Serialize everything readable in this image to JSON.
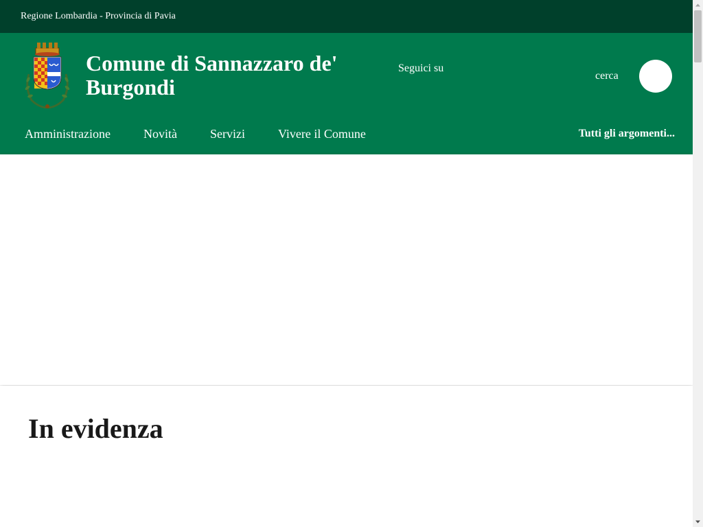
{
  "topbar": {
    "region_text": "Regione Lombardia - Provincia di Pavia"
  },
  "header": {
    "title": "Comune di Sannazzaro de' Burgondi",
    "follow_label": "Seguici su",
    "search_label": "cerca"
  },
  "nav": {
    "items": [
      {
        "label": "Amministrazione"
      },
      {
        "label": "Novità"
      },
      {
        "label": "Servizi"
      },
      {
        "label": "Vivere il Comune"
      }
    ],
    "all_topics": "Tutti gli argomenti..."
  },
  "featured": {
    "title": "In evidenza"
  },
  "colors": {
    "topbar_bg": "#00402b",
    "header_bg": "#007a4d",
    "text_light": "#ffffff",
    "heading_dark": "#191919"
  },
  "icons": {
    "logo": "coat-of-arms-icon",
    "search": "search-icon"
  }
}
